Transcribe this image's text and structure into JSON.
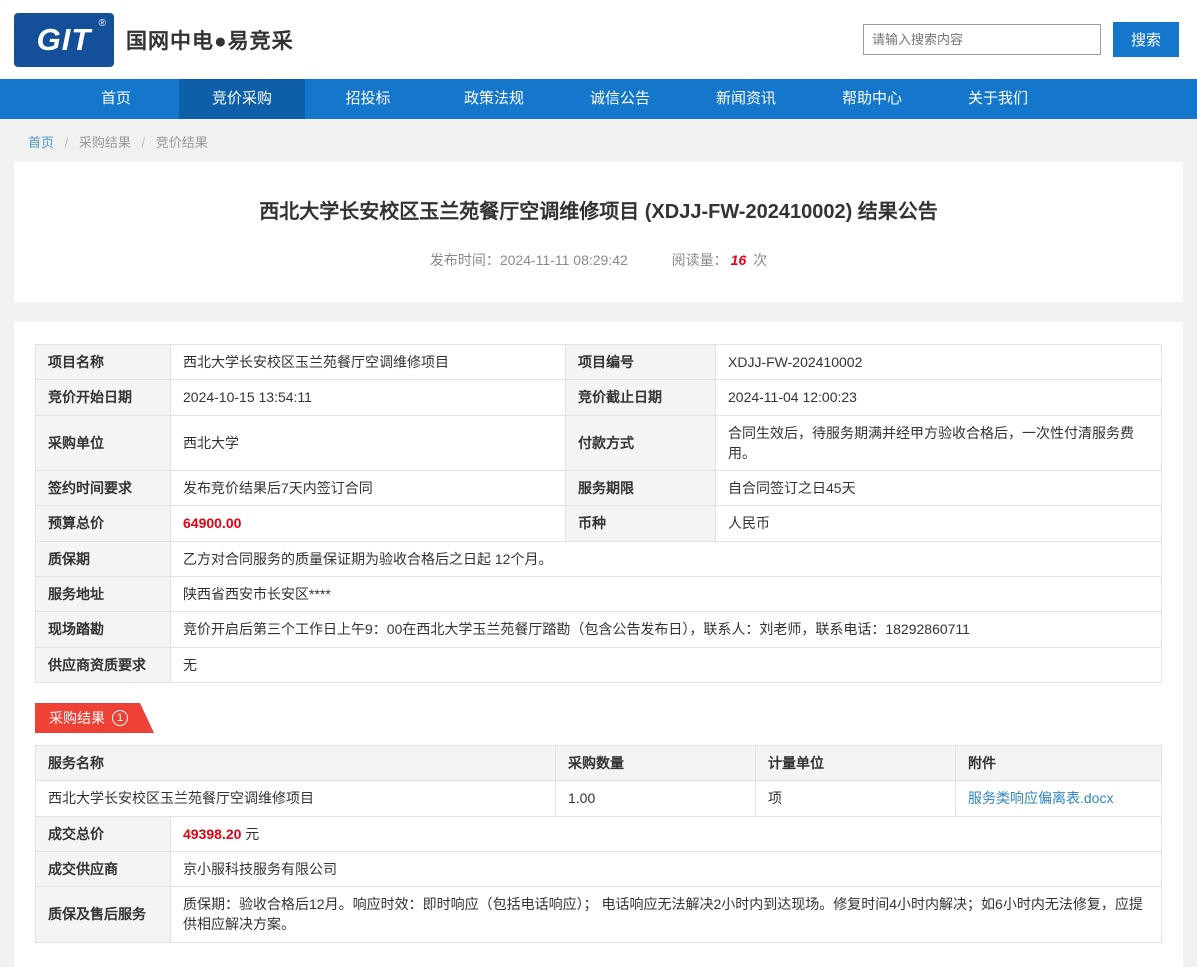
{
  "header": {
    "logo_text": "GIT",
    "logo_reg": "®",
    "brand": "国网中电●易竞采",
    "search_placeholder": "请输入搜索内容",
    "search_button": "搜索"
  },
  "nav": {
    "items": [
      {
        "label": "首页",
        "active": false
      },
      {
        "label": "竞价采购",
        "active": true
      },
      {
        "label": "招投标",
        "active": false
      },
      {
        "label": "政策法规",
        "active": false
      },
      {
        "label": "诚信公告",
        "active": false
      },
      {
        "label": "新闻资讯",
        "active": false
      },
      {
        "label": "帮助中心",
        "active": false
      },
      {
        "label": "关于我们",
        "active": false
      }
    ]
  },
  "breadcrumb": {
    "separator": "/",
    "items": [
      "首页",
      "采购结果",
      "竞价结果"
    ]
  },
  "article": {
    "title": "西北大学长安校区玉兰苑餐厅空调维修项目 (XDJJ-FW-202410002) 结果公告",
    "publish_label": "发布时间：",
    "publish_time": "2024-11-11 08:29:42",
    "views_label": "阅读量：",
    "views_count": "16",
    "views_unit": "次"
  },
  "info": {
    "pairs": [
      {
        "l1": "项目名称",
        "v1": "西北大学长安校区玉兰苑餐厅空调维修项目",
        "l2": "项目编号",
        "v2": "XDJJ-FW-202410002"
      },
      {
        "l1": "竞价开始日期",
        "v1": "2024-10-15 13:54:11",
        "l2": "竞价截止日期",
        "v2": "2024-11-04 12:00:23"
      },
      {
        "l1": "采购单位",
        "v1": "西北大学",
        "l2": "付款方式",
        "v2": "合同生效后，待服务期满并经甲方验收合格后，一次性付清服务费用。"
      },
      {
        "l1": "签约时间要求",
        "v1": "发布竞价结果后7天内签订合同",
        "l2": "服务期限",
        "v2": "自合同签订之日45天"
      },
      {
        "l1": "预算总价",
        "v1": "64900.00",
        "l2": "币种",
        "v2": "人民币"
      }
    ],
    "fulls": [
      {
        "label": "质保期",
        "value": "乙方对合同服务的质量保证期为验收合格后之日起 12个月。"
      },
      {
        "label": "服务地址",
        "value": "陕西省西安市长安区****"
      },
      {
        "label": "现场踏勘",
        "value": "竞价开启后第三个工作日上午9：00在西北大学玉兰苑餐厅踏勘（包含公告发布日），联系人：刘老师，联系电话：18292860711"
      },
      {
        "label": "供应商资质要求",
        "value": "无"
      }
    ]
  },
  "result": {
    "ribbon_label": "采购结果",
    "ribbon_badge": "1",
    "headers": [
      "服务名称",
      "采购数量",
      "计量单位",
      "附件"
    ],
    "item": {
      "name": "西北大学长安校区玉兰苑餐厅空调维修项目",
      "quantity": "1.00",
      "unit": "项",
      "attachment": "服务类响应偏离表.docx"
    },
    "deal_price_label": "成交总价",
    "deal_price": "49398.20",
    "deal_price_unit": "元",
    "supplier_label": "成交供应商",
    "supplier": "京小服科技服务有限公司",
    "warranty_label": "质保及售后服务",
    "warranty": "质保期：验收合格后12月。响应时效：即时响应（包括电话响应）； 电话响应无法解决2小时内到达现场。修复时间4小时内解决；如6小时内无法修复，应提供相应解决方案。"
  },
  "colors": {
    "nav_blue": "#1577cb",
    "nav_active_blue": "#0e5fa9",
    "logo_blue": "#14509a",
    "accent_red": "#e60012",
    "ribbon_red": "#ef4136",
    "link_blue": "#2f85c9",
    "label_bg": "#f4f4f4",
    "border": "#e2e2e2",
    "page_bg": "#f1f1f2"
  }
}
